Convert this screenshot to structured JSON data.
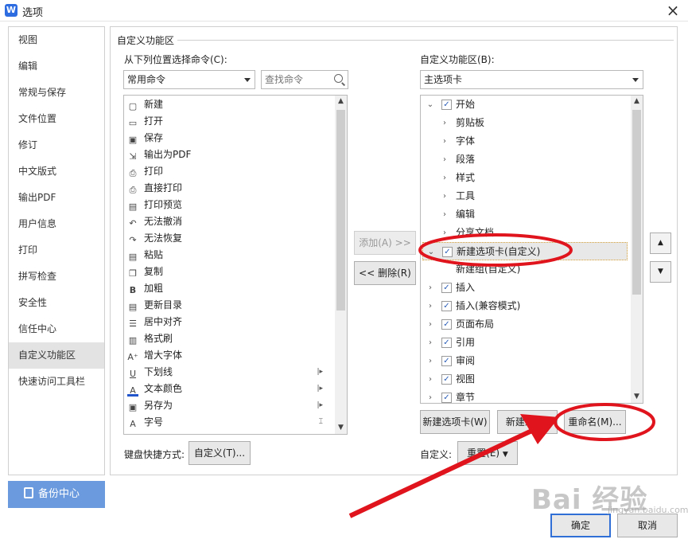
{
  "window": {
    "title": "选项",
    "logo": "W"
  },
  "sidebar": {
    "items": [
      {
        "label": "视图"
      },
      {
        "label": "编辑"
      },
      {
        "label": "常规与保存"
      },
      {
        "label": "文件位置"
      },
      {
        "label": "修订"
      },
      {
        "label": "中文版式"
      },
      {
        "label": "输出PDF"
      },
      {
        "label": "用户信息"
      },
      {
        "label": "打印"
      },
      {
        "label": "拼写检查"
      },
      {
        "label": "安全性"
      },
      {
        "label": "信任中心"
      },
      {
        "label": "自定义功能区"
      },
      {
        "label": "快速访问工具栏"
      }
    ],
    "active_index": 12,
    "backup_label": "备份中心"
  },
  "main": {
    "section_title": "自定义功能区",
    "left": {
      "label": "从下列位置选择命令(C):",
      "combo_value": "常用命令",
      "search_placeholder": "查找命令",
      "commands": [
        {
          "label": "新建",
          "icon": "new-doc-icon",
          "glyph": "▢"
        },
        {
          "label": "打开",
          "icon": "folder-open-icon",
          "glyph": "▭"
        },
        {
          "label": "保存",
          "icon": "save-icon",
          "glyph": "▣"
        },
        {
          "label": "输出为PDF",
          "icon": "pdf-export-icon",
          "glyph": "⇲"
        },
        {
          "label": "打印",
          "icon": "printer-icon",
          "glyph": "⎙"
        },
        {
          "label": "直接打印",
          "icon": "direct-print-icon",
          "glyph": "⎙"
        },
        {
          "label": "打印预览",
          "icon": "print-preview-icon",
          "glyph": "▤"
        },
        {
          "label": "无法撤消",
          "icon": "undo-icon",
          "glyph": "↶"
        },
        {
          "label": "无法恢复",
          "icon": "redo-icon",
          "glyph": "↷"
        },
        {
          "label": "粘贴",
          "icon": "paste-icon",
          "glyph": "▤"
        },
        {
          "label": "复制",
          "icon": "copy-icon",
          "glyph": "❐"
        },
        {
          "label": "加粗",
          "icon": "bold-icon",
          "glyph": "B"
        },
        {
          "label": "更新目录",
          "icon": "update-toc-icon",
          "glyph": "▤"
        },
        {
          "label": "居中对齐",
          "icon": "align-center-icon",
          "glyph": "☰"
        },
        {
          "label": "格式刷",
          "icon": "format-painter-icon",
          "glyph": "▥"
        },
        {
          "label": "增大字体",
          "icon": "grow-font-icon",
          "glyph": "A⁺"
        },
        {
          "label": "下划线",
          "icon": "underline-icon",
          "glyph": "U"
        },
        {
          "label": "文本颜色",
          "icon": "font-color-icon",
          "glyph": "A"
        },
        {
          "label": "另存为",
          "icon": "save-as-icon",
          "glyph": "▣"
        },
        {
          "label": "字号",
          "icon": "font-size-icon",
          "glyph": "A"
        }
      ],
      "shortcut_label": "键盘快捷方式:",
      "customize_button": "自定义(T)..."
    },
    "add_button": "添加(A) >>",
    "remove_button": "<< 删除(R)",
    "right": {
      "label": "自定义功能区(B):",
      "combo_value": "主选项卡",
      "tree": [
        {
          "label": "开始",
          "level": 0,
          "expanded": true,
          "checked": true
        },
        {
          "label": "剪贴板",
          "level": 1
        },
        {
          "label": "字体",
          "level": 1
        },
        {
          "label": "段落",
          "level": 1
        },
        {
          "label": "样式",
          "level": 1
        },
        {
          "label": "工具",
          "level": 1
        },
        {
          "label": "编辑",
          "level": 1
        },
        {
          "label": "分享文档",
          "level": 1
        },
        {
          "label": "新建选项卡(自定义)",
          "level": 0,
          "expanded": true,
          "checked": true,
          "selected": true
        },
        {
          "label": "新建组(自定义)",
          "level": 2
        },
        {
          "label": "插入",
          "level": 0,
          "checked": true
        },
        {
          "label": "插入(兼容模式)",
          "level": 0,
          "checked": true
        },
        {
          "label": "页面布局",
          "level": 0,
          "checked": true
        },
        {
          "label": "引用",
          "level": 0,
          "checked": true
        },
        {
          "label": "审阅",
          "level": 0,
          "checked": true
        },
        {
          "label": "视图",
          "level": 0,
          "checked": true
        },
        {
          "label": "章节",
          "level": 0,
          "checked": true
        }
      ],
      "new_tab_button": "新建选项卡(W)",
      "new_group_button": "新建组(N)",
      "rename_button": "重命名(M)...",
      "customize_label": "自定义:",
      "reset_button": "重置(E)"
    }
  },
  "footer": {
    "ok_button": "确定",
    "cancel_button": "取消"
  },
  "watermark": {
    "text": "Bai 经验",
    "sub": "jingyan.baidu.com"
  },
  "colors": {
    "annotation": "#e0141c",
    "accent": "#2f6fd6",
    "backup": "#6b9bde"
  }
}
